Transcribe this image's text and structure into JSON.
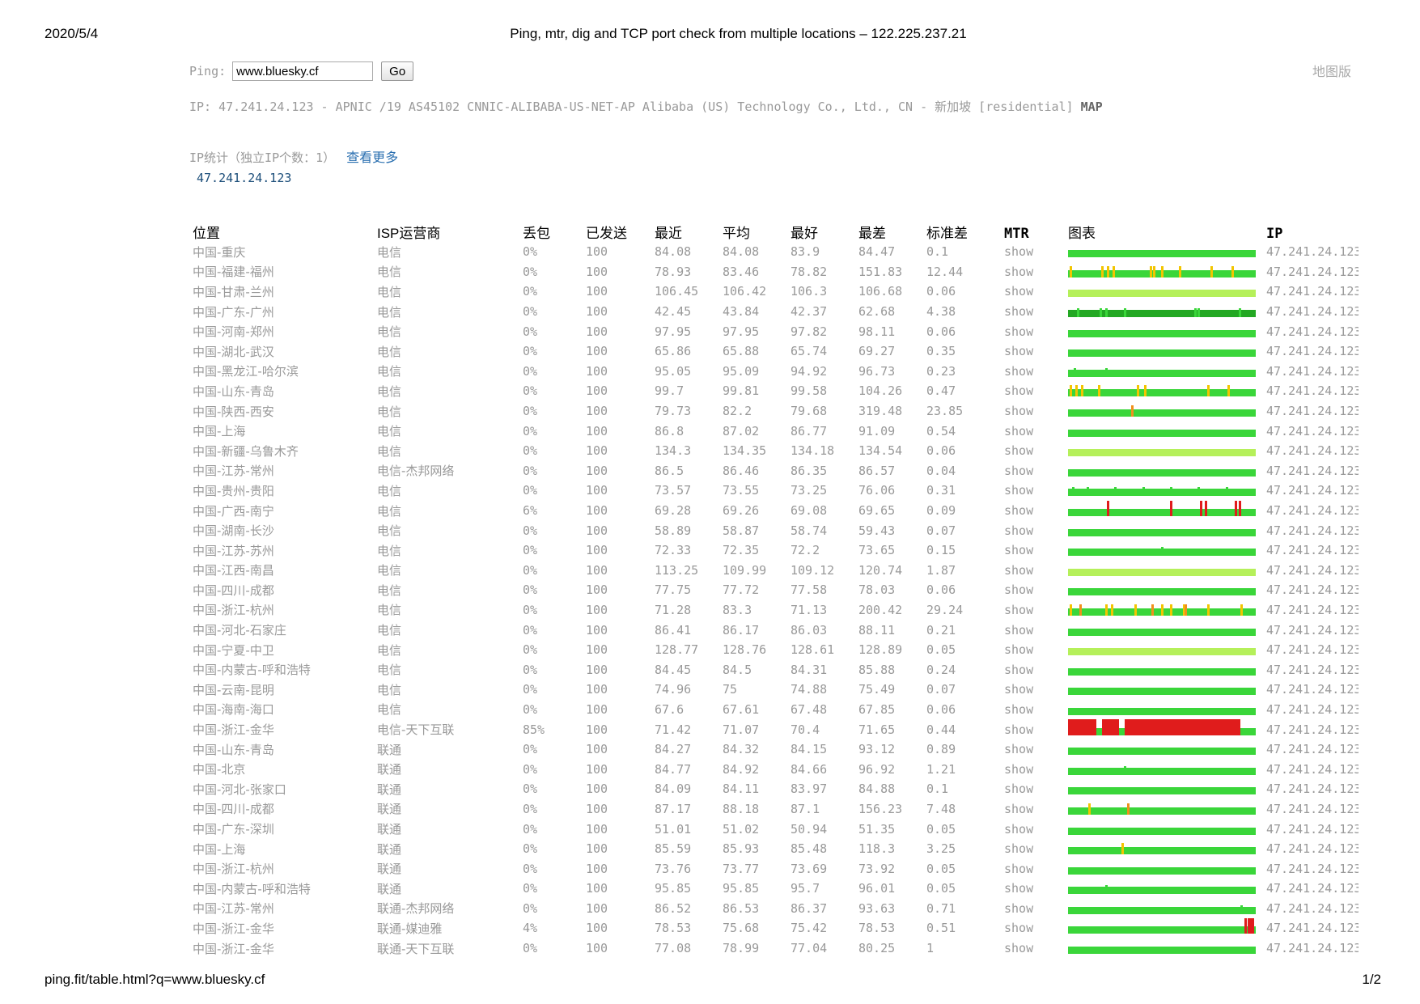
{
  "print": {
    "date": "2020/5/4",
    "title": "Ping, mtr, dig and TCP port check from multiple locations – 122.225.237.21",
    "url": "ping.fit/table.html?q=www.bluesky.cf",
    "page": "1/2"
  },
  "search": {
    "label": "Ping:",
    "value": "www.bluesky.cf",
    "button": "Go",
    "map_link": "地图版"
  },
  "ip_info": {
    "text": "IP: 47.241.24.123 - APNIC /19 AS45102 CNNIC-ALIBABA-US-NET-AP Alibaba (US) Technology Co., Ltd., CN - 新加坡 [residential]",
    "map": "MAP"
  },
  "ip_stats": {
    "label": "IP统计（独立IP个数：1）",
    "more": "查看更多",
    "ips": [
      "47.241.24.123"
    ]
  },
  "colors": {
    "good": "#3ad63a",
    "ok": "#b5f05a",
    "dark_good": "#23a823",
    "warn": "#f2c500",
    "orange": "#f0901c",
    "loss": "#e01c1c"
  },
  "table": {
    "headers": [
      "位置",
      "ISP运营商",
      "丢包",
      "已发送",
      "最近",
      "平均",
      "最好",
      "最差",
      "标准差",
      "MTR",
      "图表",
      "IP"
    ],
    "rows": [
      {
        "loc": "中国-重庆",
        "isp": "电信",
        "loss": "0%",
        "sent": "100",
        "last": "84.08",
        "avg": "84.08",
        "best": "83.9",
        "worst": "84.47",
        "stdev": "0.1",
        "mtr": "show",
        "ip": "47.241.24.123",
        "bar": "good",
        "spikes": []
      },
      {
        "loc": "中国-福建-福州",
        "isp": "电信",
        "loss": "0%",
        "sent": "100",
        "last": "78.93",
        "avg": "83.46",
        "best": "78.82",
        "worst": "151.83",
        "stdev": "12.44",
        "mtr": "show",
        "ip": "47.241.24.123",
        "bar": "good",
        "spikes": [
          [
            1,
            "warn"
          ],
          [
            18,
            "warn"
          ],
          [
            21,
            "warn"
          ],
          [
            24,
            "warn"
          ],
          [
            44,
            "warn"
          ],
          [
            46,
            "warn"
          ],
          [
            50,
            "warn"
          ],
          [
            60,
            "warn"
          ],
          [
            77,
            "warn"
          ],
          [
            88,
            "warn"
          ]
        ]
      },
      {
        "loc": "中国-甘肃-兰州",
        "isp": "电信",
        "loss": "0%",
        "sent": "100",
        "last": "106.45",
        "avg": "106.42",
        "best": "106.3",
        "worst": "106.68",
        "stdev": "0.06",
        "mtr": "show",
        "ip": "47.241.24.123",
        "bar": "ok",
        "spikes": []
      },
      {
        "loc": "中国-广东-广州",
        "isp": "电信",
        "loss": "0%",
        "sent": "100",
        "last": "42.45",
        "avg": "43.84",
        "best": "42.37",
        "worst": "62.68",
        "stdev": "4.38",
        "mtr": "show",
        "ip": "47.241.24.123",
        "bar": "dark_good",
        "spikes": [
          [
            5,
            "good"
          ],
          [
            17,
            "good"
          ],
          [
            20,
            "good"
          ],
          [
            30,
            "good"
          ],
          [
            68,
            "good"
          ],
          [
            70,
            "good"
          ],
          [
            92,
            "good"
          ]
        ]
      },
      {
        "loc": "中国-河南-郑州",
        "isp": "电信",
        "loss": "0%",
        "sent": "100",
        "last": "97.95",
        "avg": "97.95",
        "best": "97.82",
        "worst": "98.11",
        "stdev": "0.06",
        "mtr": "show",
        "ip": "47.241.24.123",
        "bar": "good",
        "spikes": []
      },
      {
        "loc": "中国-湖北-武汉",
        "isp": "电信",
        "loss": "0%",
        "sent": "100",
        "last": "65.86",
        "avg": "65.88",
        "best": "65.74",
        "worst": "69.27",
        "stdev": "0.35",
        "mtr": "show",
        "ip": "47.241.24.123",
        "bar": "good",
        "spikes": []
      },
      {
        "loc": "中国-黑龙江-哈尔滨",
        "isp": "电信",
        "loss": "0%",
        "sent": "100",
        "last": "95.05",
        "avg": "95.09",
        "best": "94.92",
        "worst": "96.73",
        "stdev": "0.23",
        "mtr": "show",
        "ip": "47.241.24.123",
        "bar": "good",
        "spikes": [
          [
            3,
            "good"
          ],
          [
            20,
            "good"
          ]
        ]
      },
      {
        "loc": "中国-山东-青岛",
        "isp": "电信",
        "loss": "0%",
        "sent": "100",
        "last": "99.7",
        "avg": "99.81",
        "best": "99.58",
        "worst": "104.26",
        "stdev": "0.47",
        "mtr": "show",
        "ip": "47.241.24.123",
        "bar": "good",
        "spikes": [
          [
            1,
            "warn"
          ],
          [
            4,
            "warn"
          ],
          [
            7,
            "warn"
          ],
          [
            16,
            "warn"
          ],
          [
            37,
            "warn"
          ],
          [
            41,
            "warn"
          ],
          [
            75,
            "warn"
          ],
          [
            86,
            "warn"
          ]
        ]
      },
      {
        "loc": "中国-陕西-西安",
        "isp": "电信",
        "loss": "0%",
        "sent": "100",
        "last": "79.73",
        "avg": "82.2",
        "best": "79.68",
        "worst": "319.48",
        "stdev": "23.85",
        "mtr": "show",
        "ip": "47.241.24.123",
        "bar": "good",
        "spikes": [
          [
            34,
            "orange"
          ]
        ]
      },
      {
        "loc": "中国-上海",
        "isp": "电信",
        "loss": "0%",
        "sent": "100",
        "last": "86.8",
        "avg": "87.02",
        "best": "86.77",
        "worst": "91.09",
        "stdev": "0.54",
        "mtr": "show",
        "ip": "47.241.24.123",
        "bar": "good",
        "spikes": []
      },
      {
        "loc": "中国-新疆-乌鲁木齐",
        "isp": "电信",
        "loss": "0%",
        "sent": "100",
        "last": "134.3",
        "avg": "134.35",
        "best": "134.18",
        "worst": "134.54",
        "stdev": "0.06",
        "mtr": "show",
        "ip": "47.241.24.123",
        "bar": "ok",
        "spikes": []
      },
      {
        "loc": "中国-江苏-常州",
        "isp": "电信-杰邦网络",
        "loss": "0%",
        "sent": "100",
        "last": "86.5",
        "avg": "86.46",
        "best": "86.35",
        "worst": "86.57",
        "stdev": "0.04",
        "mtr": "show",
        "ip": "47.241.24.123",
        "bar": "good",
        "spikes": []
      },
      {
        "loc": "中国-贵州-贵阳",
        "isp": "电信",
        "loss": "0%",
        "sent": "100",
        "last": "73.57",
        "avg": "73.55",
        "best": "73.25",
        "worst": "76.06",
        "stdev": "0.31",
        "mtr": "show",
        "ip": "47.241.24.123",
        "bar": "good",
        "spikes": [
          [
            2,
            "good"
          ],
          [
            10,
            "good"
          ],
          [
            25,
            "good"
          ],
          [
            40,
            "good"
          ],
          [
            55,
            "good"
          ],
          [
            70,
            "good"
          ],
          [
            85,
            "good"
          ]
        ]
      },
      {
        "loc": "中国-广西-南宁",
        "isp": "电信",
        "loss": "6%",
        "sent": "100",
        "last": "69.28",
        "avg": "69.26",
        "best": "69.08",
        "worst": "69.65",
        "stdev": "0.09",
        "mtr": "show",
        "ip": "47.241.24.123",
        "bar": "good",
        "spikes": [
          [
            21,
            "loss"
          ],
          [
            55,
            "loss"
          ],
          [
            71,
            "loss"
          ],
          [
            74,
            "loss"
          ],
          [
            90,
            "loss"
          ],
          [
            92,
            "loss"
          ]
        ]
      },
      {
        "loc": "中国-湖南-长沙",
        "isp": "电信",
        "loss": "0%",
        "sent": "100",
        "last": "58.89",
        "avg": "58.87",
        "best": "58.74",
        "worst": "59.43",
        "stdev": "0.07",
        "mtr": "show",
        "ip": "47.241.24.123",
        "bar": "good",
        "spikes": []
      },
      {
        "loc": "中国-江苏-苏州",
        "isp": "电信",
        "loss": "0%",
        "sent": "100",
        "last": "72.33",
        "avg": "72.35",
        "best": "72.2",
        "worst": "73.65",
        "stdev": "0.15",
        "mtr": "show",
        "ip": "47.241.24.123",
        "bar": "good",
        "spikes": [
          [
            50,
            "good"
          ]
        ]
      },
      {
        "loc": "中国-江西-南昌",
        "isp": "电信",
        "loss": "0%",
        "sent": "100",
        "last": "113.25",
        "avg": "109.99",
        "best": "109.12",
        "worst": "120.74",
        "stdev": "1.87",
        "mtr": "show",
        "ip": "47.241.24.123",
        "bar": "ok",
        "spikes": []
      },
      {
        "loc": "中国-四川-成都",
        "isp": "电信",
        "loss": "0%",
        "sent": "100",
        "last": "77.75",
        "avg": "77.72",
        "best": "77.58",
        "worst": "78.03",
        "stdev": "0.06",
        "mtr": "show",
        "ip": "47.241.24.123",
        "bar": "good",
        "spikes": []
      },
      {
        "loc": "中国-浙江-杭州",
        "isp": "电信",
        "loss": "0%",
        "sent": "100",
        "last": "71.28",
        "avg": "83.3",
        "best": "71.13",
        "worst": "200.42",
        "stdev": "29.24",
        "mtr": "show",
        "ip": "47.241.24.123",
        "bar": "good",
        "spikes": [
          [
            1,
            "warn"
          ],
          [
            6,
            "orange"
          ],
          [
            20,
            "warn"
          ],
          [
            23,
            "warn"
          ],
          [
            36,
            "warn"
          ],
          [
            45,
            "orange"
          ],
          [
            50,
            "warn"
          ],
          [
            55,
            "warn"
          ],
          [
            62,
            "warn"
          ],
          [
            63,
            "orange"
          ],
          [
            75,
            "warn"
          ],
          [
            93,
            "warn"
          ]
        ]
      },
      {
        "loc": "中国-河北-石家庄",
        "isp": "电信",
        "loss": "0%",
        "sent": "100",
        "last": "86.41",
        "avg": "86.17",
        "best": "86.03",
        "worst": "88.11",
        "stdev": "0.21",
        "mtr": "show",
        "ip": "47.241.24.123",
        "bar": "good",
        "spikes": []
      },
      {
        "loc": "中国-宁夏-中卫",
        "isp": "电信",
        "loss": "0%",
        "sent": "100",
        "last": "128.77",
        "avg": "128.76",
        "best": "128.61",
        "worst": "128.89",
        "stdev": "0.05",
        "mtr": "show",
        "ip": "47.241.24.123",
        "bar": "ok",
        "spikes": []
      },
      {
        "loc": "中国-内蒙古-呼和浩特",
        "isp": "电信",
        "loss": "0%",
        "sent": "100",
        "last": "84.45",
        "avg": "84.5",
        "best": "84.31",
        "worst": "85.88",
        "stdev": "0.24",
        "mtr": "show",
        "ip": "47.241.24.123",
        "bar": "good",
        "spikes": []
      },
      {
        "loc": "中国-云南-昆明",
        "isp": "电信",
        "loss": "0%",
        "sent": "100",
        "last": "74.96",
        "avg": "75",
        "best": "74.88",
        "worst": "75.49",
        "stdev": "0.07",
        "mtr": "show",
        "ip": "47.241.24.123",
        "bar": "good",
        "spikes": []
      },
      {
        "loc": "中国-海南-海口",
        "isp": "电信",
        "loss": "0%",
        "sent": "100",
        "last": "67.6",
        "avg": "67.61",
        "best": "67.48",
        "worst": "67.85",
        "stdev": "0.06",
        "mtr": "show",
        "ip": "47.241.24.123",
        "bar": "good",
        "spikes": []
      },
      {
        "loc": "中国-浙江-金华",
        "isp": "电信-天下互联",
        "loss": "85%",
        "sent": "100",
        "last": "71.42",
        "avg": "71.07",
        "best": "70.4",
        "worst": "71.65",
        "stdev": "0.44",
        "mtr": "show",
        "ip": "47.241.24.123",
        "bar": "good",
        "blocks": [
          [
            0,
            15
          ],
          [
            18,
            27
          ],
          [
            30,
            92
          ]
        ]
      },
      {
        "loc": "中国-山东-青岛",
        "isp": "联通",
        "loss": "0%",
        "sent": "100",
        "last": "84.27",
        "avg": "84.32",
        "best": "84.15",
        "worst": "93.12",
        "stdev": "0.89",
        "mtr": "show",
        "ip": "47.241.24.123",
        "bar": "good",
        "spikes": []
      },
      {
        "loc": "中国-北京",
        "isp": "联通",
        "loss": "0%",
        "sent": "100",
        "last": "84.77",
        "avg": "84.92",
        "best": "84.66",
        "worst": "96.92",
        "stdev": "1.21",
        "mtr": "show",
        "ip": "47.241.24.123",
        "bar": "good",
        "spikes": [
          [
            30,
            "good"
          ]
        ]
      },
      {
        "loc": "中国-河北-张家口",
        "isp": "联通",
        "loss": "0%",
        "sent": "100",
        "last": "84.09",
        "avg": "84.11",
        "best": "83.97",
        "worst": "84.88",
        "stdev": "0.1",
        "mtr": "show",
        "ip": "47.241.24.123",
        "bar": "good",
        "spikes": []
      },
      {
        "loc": "中国-四川-成都",
        "isp": "联通",
        "loss": "0%",
        "sent": "100",
        "last": "87.17",
        "avg": "88.18",
        "best": "87.1",
        "worst": "156.23",
        "stdev": "7.48",
        "mtr": "show",
        "ip": "47.241.24.123",
        "bar": "good",
        "spikes": [
          [
            11,
            "warn"
          ],
          [
            32,
            "orange"
          ]
        ]
      },
      {
        "loc": "中国-广东-深圳",
        "isp": "联通",
        "loss": "0%",
        "sent": "100",
        "last": "51.01",
        "avg": "51.02",
        "best": "50.94",
        "worst": "51.35",
        "stdev": "0.05",
        "mtr": "show",
        "ip": "47.241.24.123",
        "bar": "good",
        "spikes": []
      },
      {
        "loc": "中国-上海",
        "isp": "联通",
        "loss": "0%",
        "sent": "100",
        "last": "85.59",
        "avg": "85.93",
        "best": "85.48",
        "worst": "118.3",
        "stdev": "3.25",
        "mtr": "show",
        "ip": "47.241.24.123",
        "bar": "good",
        "spikes": [
          [
            29,
            "warn"
          ]
        ]
      },
      {
        "loc": "中国-浙江-杭州",
        "isp": "联通",
        "loss": "0%",
        "sent": "100",
        "last": "73.76",
        "avg": "73.77",
        "best": "73.69",
        "worst": "73.92",
        "stdev": "0.05",
        "mtr": "show",
        "ip": "47.241.24.123",
        "bar": "good",
        "spikes": []
      },
      {
        "loc": "中国-内蒙古-呼和浩特",
        "isp": "联通",
        "loss": "0%",
        "sent": "100",
        "last": "95.85",
        "avg": "95.85",
        "best": "95.7",
        "worst": "96.01",
        "stdev": "0.05",
        "mtr": "show",
        "ip": "47.241.24.123",
        "bar": "good",
        "spikes": [
          [
            20,
            "good"
          ]
        ]
      },
      {
        "loc": "中国-江苏-常州",
        "isp": "联通-杰邦网络",
        "loss": "0%",
        "sent": "100",
        "last": "86.52",
        "avg": "86.53",
        "best": "86.37",
        "worst": "93.63",
        "stdev": "0.71",
        "mtr": "show",
        "ip": "47.241.24.123",
        "bar": "good",
        "spikes": [
          [
            93,
            "good"
          ]
        ]
      },
      {
        "loc": "中国-浙江-金华",
        "isp": "联通-媒迪雅",
        "loss": "4%",
        "sent": "100",
        "last": "78.53",
        "avg": "75.68",
        "best": "75.42",
        "worst": "78.53",
        "stdev": "0.51",
        "mtr": "show",
        "ip": "47.241.24.123",
        "bar": "good",
        "spikes": [
          [
            95,
            "loss"
          ],
          [
            97,
            "loss"
          ],
          [
            98,
            "loss"
          ],
          [
            99,
            "loss"
          ]
        ]
      },
      {
        "loc": "中国-浙江-金华",
        "isp": "联通-天下互联",
        "loss": "0%",
        "sent": "100",
        "last": "77.08",
        "avg": "78.99",
        "best": "77.04",
        "worst": "80.25",
        "stdev": "1",
        "mtr": "show",
        "ip": "47.241.24.123",
        "bar": "good",
        "spikes": []
      }
    ]
  }
}
